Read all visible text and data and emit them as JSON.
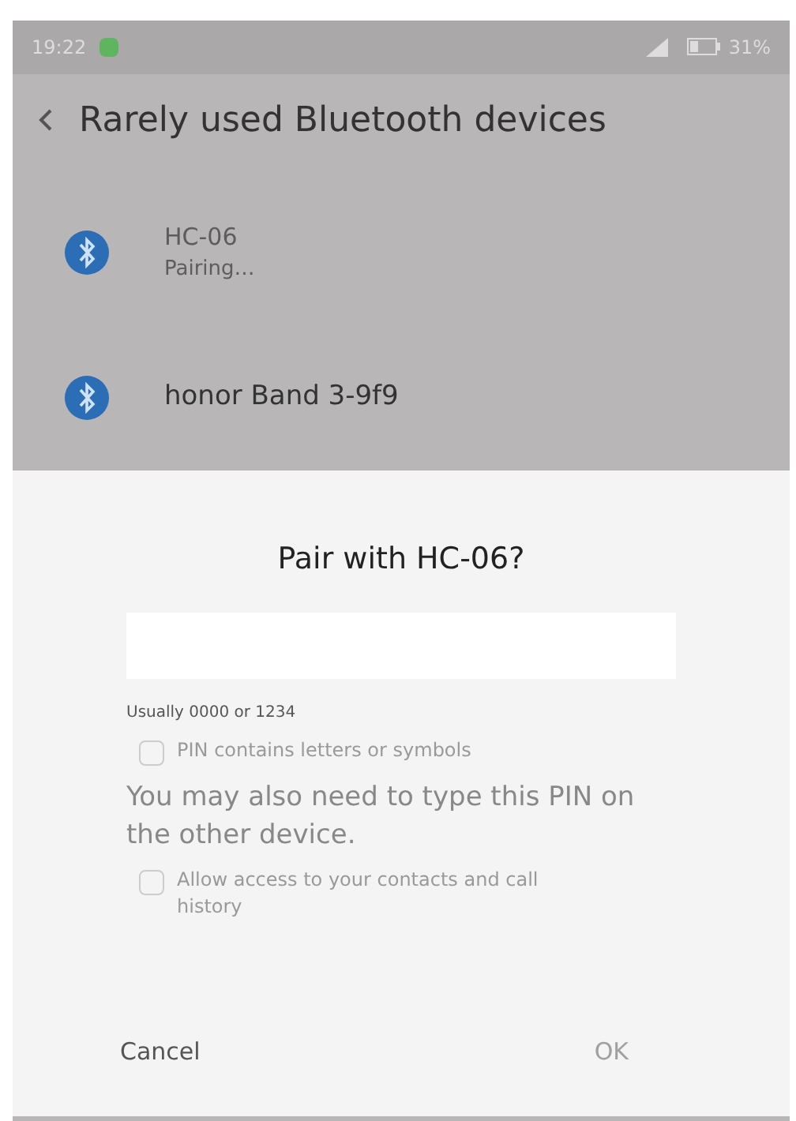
{
  "status_bar": {
    "time": "19:22",
    "battery": "31%"
  },
  "header": {
    "title": "Rarely used Bluetooth devices"
  },
  "devices": [
    {
      "name": "HC-06",
      "status": "Pairing…"
    },
    {
      "name": "honor Band 3-9f9"
    }
  ],
  "dialog": {
    "title": "Pair with HC-06?",
    "hint": "Usually 0000 or 1234",
    "options": [
      {
        "kind": "checkbox",
        "label": "PIN contains letters or symbols",
        "checked": false
      },
      {
        "kind": "note",
        "label": "You may also need to type this PIN on the other device."
      },
      {
        "kind": "checkbox",
        "label": "Allow access to your contacts and call history",
        "checked": false
      }
    ],
    "buttons": [
      {
        "label": "Cancel",
        "disabled": false
      },
      {
        "label": "OK",
        "disabled": true
      }
    ]
  }
}
